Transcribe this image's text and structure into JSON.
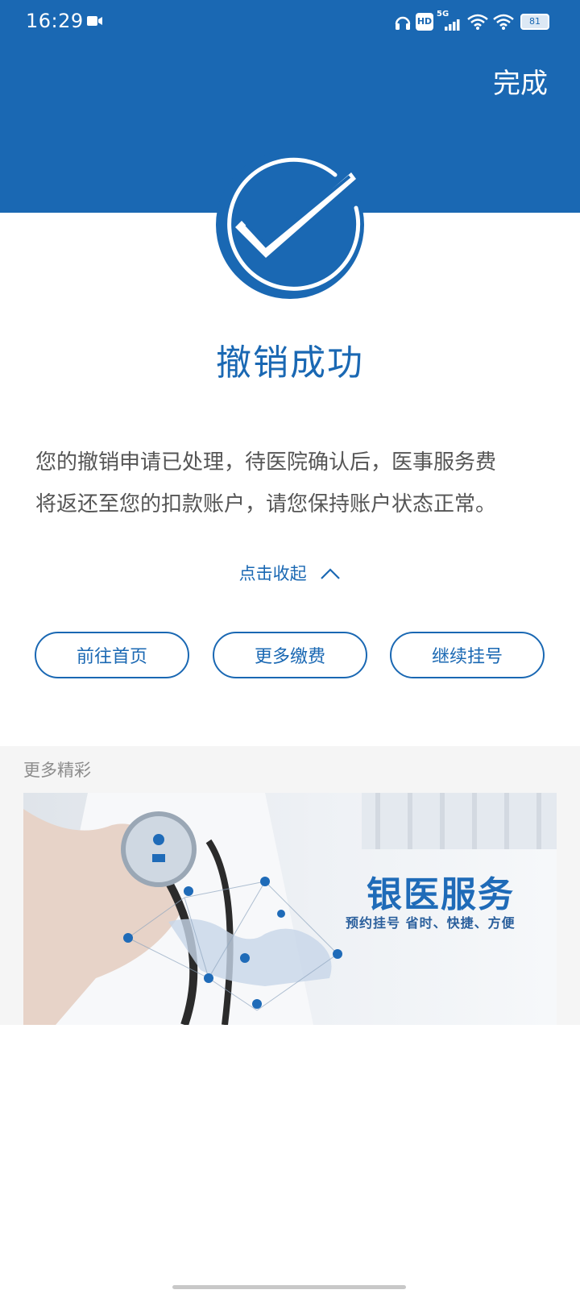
{
  "status_bar": {
    "time": "16:29",
    "signal_label": "5G",
    "hd_label": "HD",
    "battery": "81",
    "icons": [
      "video-camera-icon",
      "headphones-icon",
      "hd-icon",
      "cellular-5g-icon",
      "wifi-icon",
      "wifi-icon",
      "battery-icon"
    ]
  },
  "header": {
    "done_label": "完成",
    "accent_color": "#1a68b3"
  },
  "result": {
    "icon": "check-circle-icon",
    "title": "撤销成功",
    "message_line1": "您的撤销申请已处理，待医院确认后，医事服务费",
    "message_line2": "将返还至您的扣款账户，请您保持账户状态正常。",
    "collapse_label": "点击收起"
  },
  "actions": {
    "home_label": "前往首页",
    "pay_more_label": "更多缴费",
    "register_label": "继续挂号"
  },
  "more": {
    "section_title": "更多精彩",
    "banner_title": "银医服务",
    "banner_subtitle": "预约挂号 省时、快捷、方便"
  }
}
